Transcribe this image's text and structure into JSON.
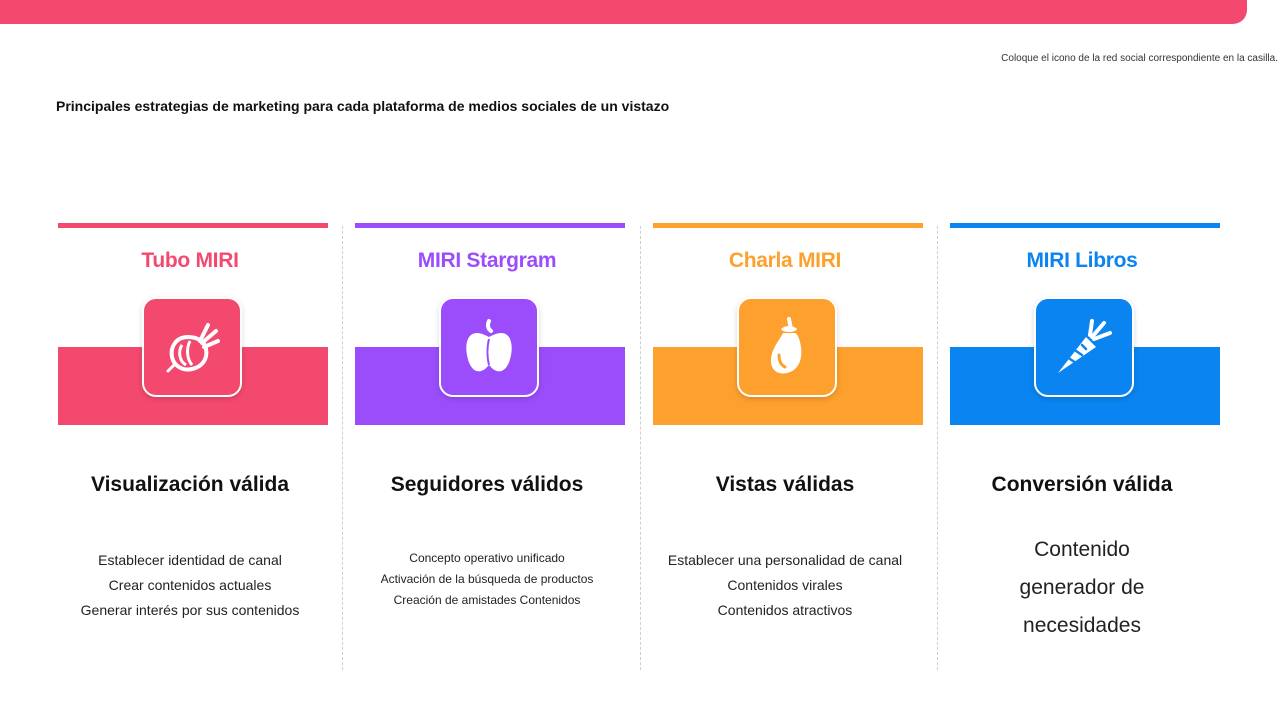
{
  "note": "Coloque el icono de la red social correspondiente en la casilla.",
  "heading": "Principales estrategias de marketing para cada plataforma de medios sociales de un vistazo",
  "colors": {
    "top_bar": "#f4496f"
  },
  "cards": [
    {
      "title": "Tubo MIRI",
      "color": "#f4496f",
      "icon": "onion-icon",
      "metric": "Visualización válida",
      "items": [
        "Establecer identidad de canal",
        "Crear contenidos actuales",
        "Generar interés por sus contenidos"
      ]
    },
    {
      "title": "MIRI Stargram",
      "color": "#9b4dfb",
      "icon": "bell-pepper-icon",
      "metric": "Seguidores válidos",
      "items": [
        "Concepto operativo unificado",
        "Activación de la búsqueda de productos",
        "Creación de amistades Contenidos"
      ]
    },
    {
      "title": "Charla MIRI",
      "color": "#fda02d",
      "icon": "eggplant-icon",
      "metric": "Vistas válidas",
      "items": [
        "Establecer una personalidad de canal",
        "Contenidos virales",
        "Contenidos atractivos"
      ]
    },
    {
      "title": "MIRI Libros",
      "color": "#0a84f0",
      "icon": "carrot-icon",
      "metric": "Conversión válida",
      "items": [
        "Contenido",
        "generador de",
        "necesidades"
      ]
    }
  ]
}
